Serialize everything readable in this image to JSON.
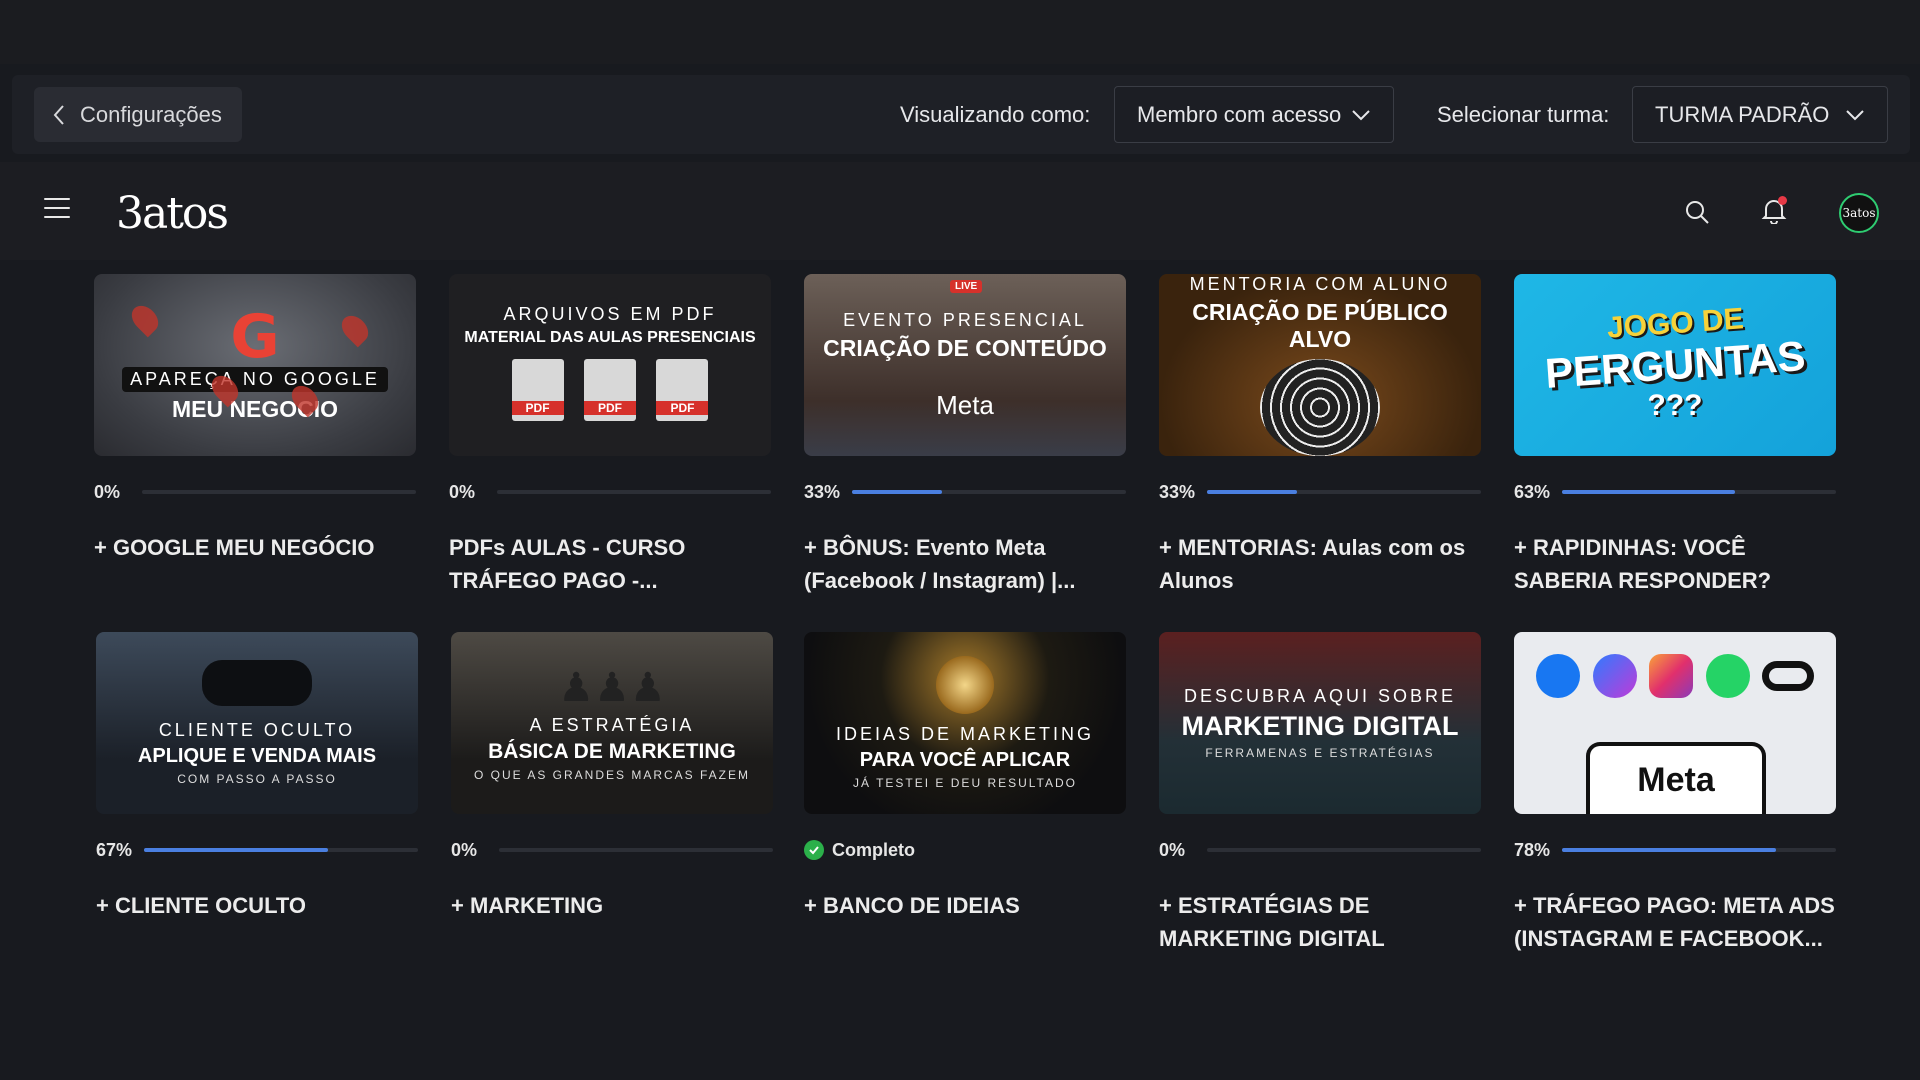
{
  "admin_bar": {
    "back_label": "Configurações",
    "view_as_label": "Visualizando como:",
    "view_as_value": "Membro com acesso",
    "class_label": "Selecionar turma:",
    "class_value": "TURMA PADRÃO"
  },
  "nav": {
    "logo": "3atos",
    "avatar_text": "3atos"
  },
  "courses": [
    {
      "thumb_lines": [
        "APAREÇA NO GOOGLE",
        "MEU NEGOCIO"
      ],
      "progress_text": "0%",
      "progress": 0,
      "title": "+ GOOGLE MEU NEGÓCIO"
    },
    {
      "thumb_lines": [
        "ARQUIVOS EM PDF",
        "MATERIAL DAS AULAS PRESENCIAIS"
      ],
      "progress_text": "0%",
      "progress": 0,
      "title": "PDFs AULAS - CURSO TRÁFEGO PAGO -..."
    },
    {
      "thumb_lines": [
        "EVENTO PRESENCIAL",
        "CRIAÇÃO DE CONTEÚDO",
        "Meta"
      ],
      "live": "LIVE",
      "progress_text": "33%",
      "progress": 33,
      "title": "+ BÔNUS: Evento Meta (Facebook / Instagram) |..."
    },
    {
      "thumb_lines": [
        "MENTORIA COM ALUNO",
        "CRIAÇÃO DE PÚBLICO ALVO"
      ],
      "progress_text": "33%",
      "progress": 33,
      "title": "+ MENTORIAS: Aulas com os Alunos"
    },
    {
      "thumb_lines": [
        "JOGO DE",
        "PERGUNTAS",
        "???"
      ],
      "progress_text": "63%",
      "progress": 63,
      "title": "+ RAPIDINHAS: VOCÊ SABERIA RESPONDER?"
    },
    {
      "thumb_lines": [
        "CLIENTE OCULTO",
        "APLIQUE E VENDA MAIS",
        "COM PASSO A PASSO"
      ],
      "progress_text": "67%",
      "progress": 67,
      "title": "+ CLIENTE OCULTO"
    },
    {
      "thumb_lines": [
        "A ESTRATÉGIA",
        "BÁSICA DE MARKETING",
        "O QUE AS GRANDES MARCAS FAZEM"
      ],
      "progress_text": "0%",
      "progress": 0,
      "title": "+ MARKETING"
    },
    {
      "thumb_lines": [
        "IDEIAS DE MARKETING",
        "PARA VOCÊ APLICAR",
        "JÁ TESTEI E DEU RESULTADO"
      ],
      "progress_text": "Completo",
      "progress": 100,
      "complete": true,
      "title": "+ BANCO DE IDEIAS"
    },
    {
      "thumb_lines": [
        "DESCUBRA AQUI SOBRE",
        "MARKETING DIGITAL",
        "FERRAMENAS E ESTRATÉGIAS"
      ],
      "progress_text": "0%",
      "progress": 0,
      "title": "+ ESTRATÉGIAS DE MARKETING DIGITAL"
    },
    {
      "thumb_lines": [
        "Meta"
      ],
      "progress_text": "78%",
      "progress": 78,
      "title": "+ TRÁFEGO PAGO: META ADS (INSTAGRAM E FACEBOOK..."
    }
  ],
  "colors": {
    "progress_fill": "#4a7fe0",
    "complete_check": "#2bb04a",
    "notification_dot": "#e63946",
    "avatar_ring": "#2ecc71"
  }
}
